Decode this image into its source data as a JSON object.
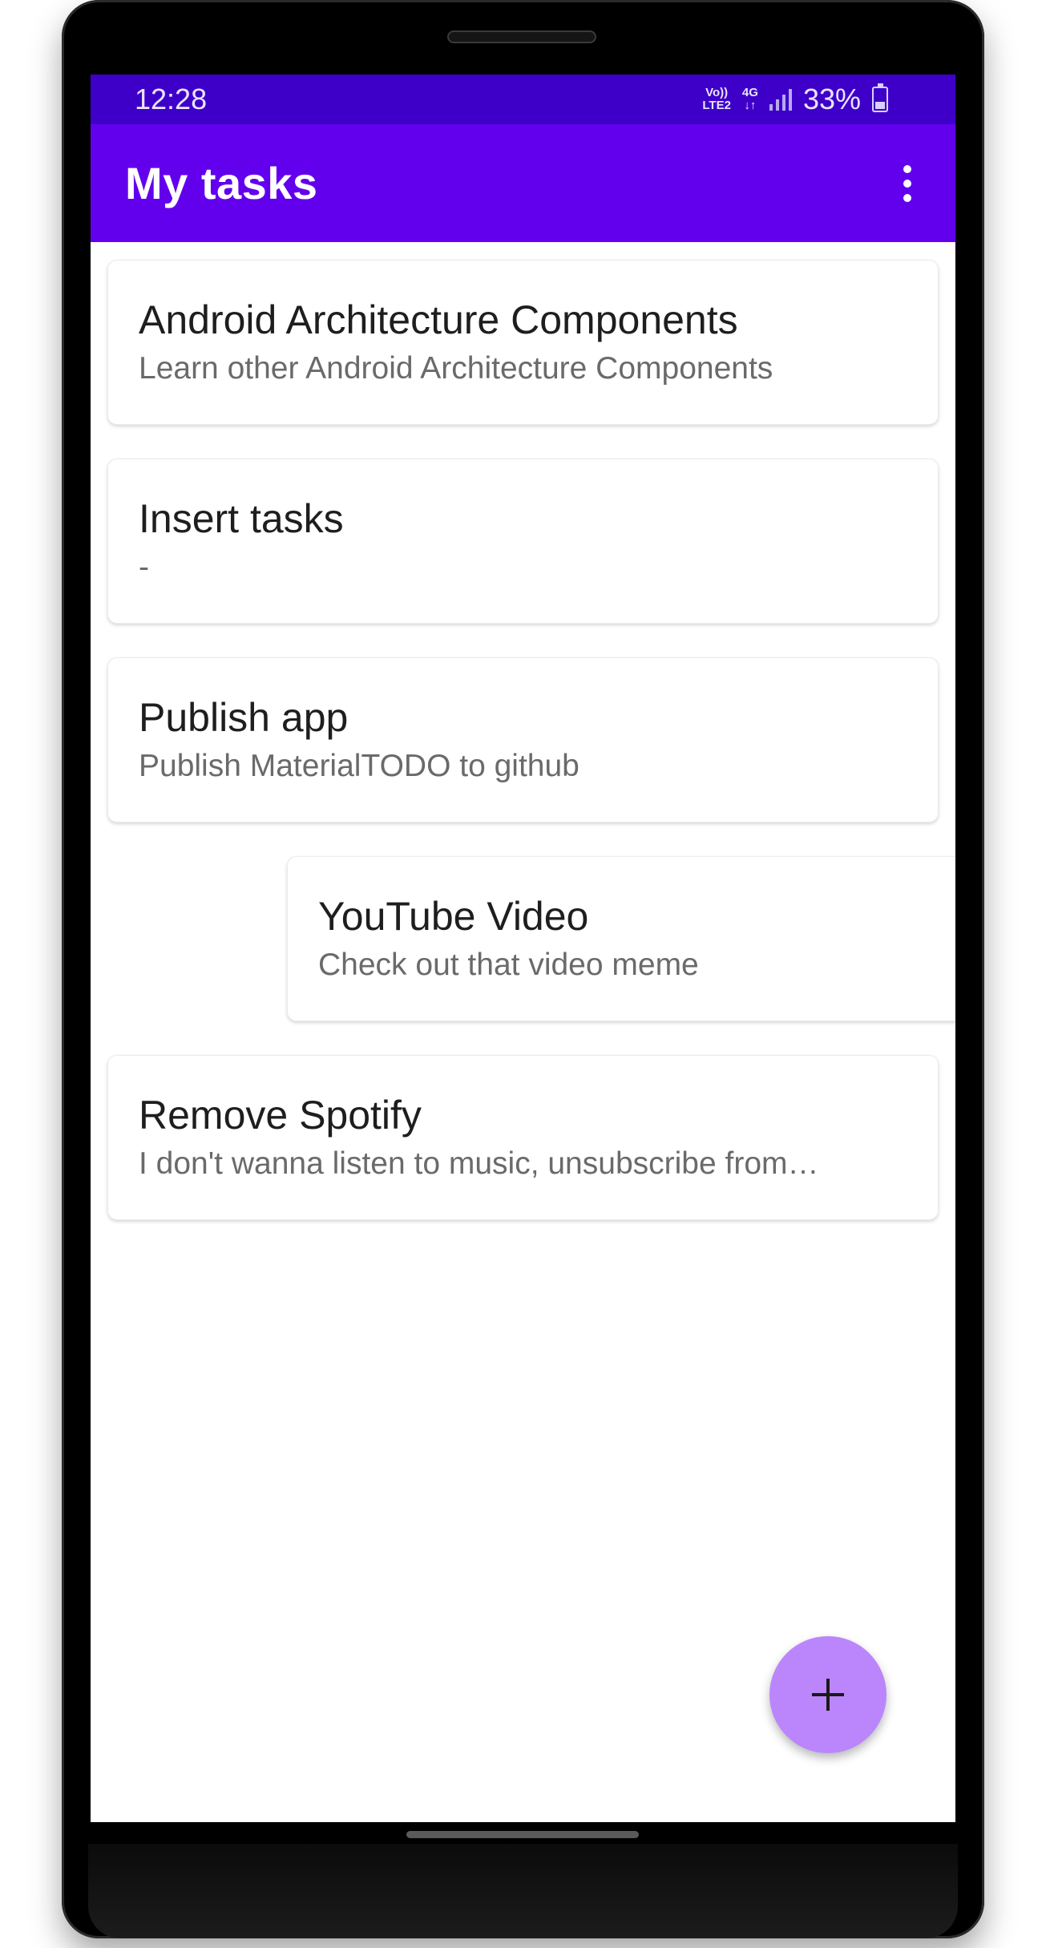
{
  "status_bar": {
    "time": "12:28",
    "volte": "Vo))",
    "lte": "LTE2",
    "network": "4G",
    "data_arrows": "↓↑",
    "battery_percent": "33%",
    "signal_icon": "cell-signal-icon",
    "battery_icon": "battery-charging-icon"
  },
  "app_bar": {
    "title": "My tasks",
    "overflow_icon": "more-vert-icon",
    "color": "#6200ee"
  },
  "tasks": [
    {
      "title": "Android Architecture Components",
      "description": "Learn other Android Architecture Components"
    },
    {
      "title": "Insert tasks",
      "description": "-"
    },
    {
      "title": "Publish app",
      "description": "Publish MaterialTODO to github"
    },
    {
      "title": "YouTube Video",
      "description": "Check out that video meme",
      "state": "swiping"
    },
    {
      "title": "Remove Spotify",
      "description": "I don't wanna listen to music, unsubscribe from…"
    }
  ],
  "fab": {
    "icon": "add-icon",
    "color": "#bb86fc"
  }
}
